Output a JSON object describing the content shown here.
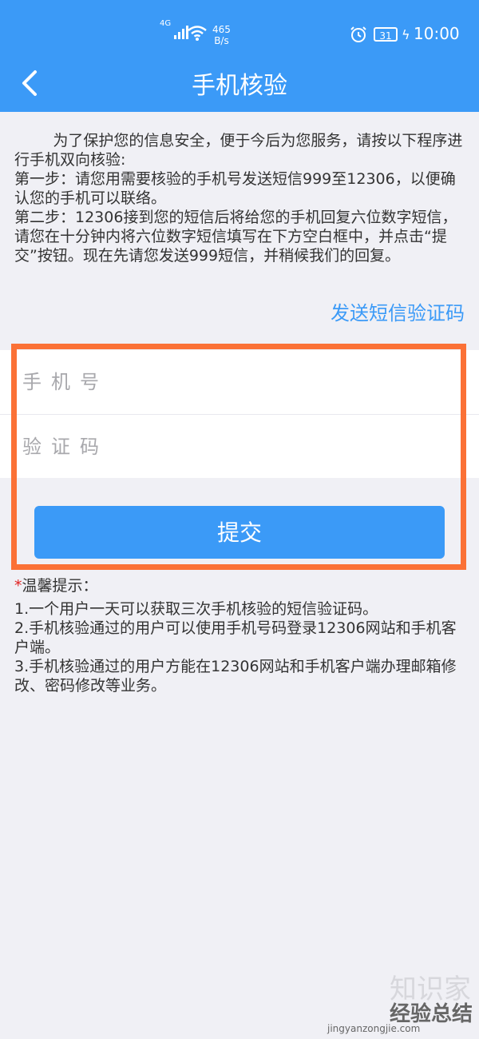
{
  "status_bar": {
    "network": "4G",
    "speed_value": "465",
    "speed_unit": "B/s",
    "battery": "31",
    "time": "10:00"
  },
  "header": {
    "title": "手机核验",
    "back_icon": "chevron-left-icon"
  },
  "intro": {
    "text": "        为了保护您的信息安全，便于今后为您服务，请按以下程序进行手机双向核验:\n第一步：请您用需要核验的手机号发送短信999至12306，以便确认您的手机可以联络。\n第二步：12306接到您的短信后将给您的手机回复六位数字短信，请您在十分钟内将六位数字短信填写在下方空白框中，并点击“提交”按钮。现在先请您发送999短信，并稍候我们的回复。"
  },
  "send_code_link": "发送短信验证码",
  "form": {
    "phone_placeholder": "手机号",
    "code_placeholder": "验证码",
    "submit_label": "提交"
  },
  "tips": {
    "star": "*",
    "title": "温馨提示：",
    "items": [
      "1.一个用户一天可以获取三次手机核验的短信验证码。",
      "2.手机核验通过的用户可以使用手机号码登录12306网站和手机客户端。",
      "3.手机核验通过的用户方能在12306网站和手机客户端办理邮箱修改、密码修改等业务。"
    ]
  },
  "watermark": {
    "faint": "知识家",
    "brand": "经验总结",
    "url": "jingyanzongjie.com"
  },
  "colors": {
    "accent": "#3b9af7",
    "highlight": "#fb7136"
  }
}
